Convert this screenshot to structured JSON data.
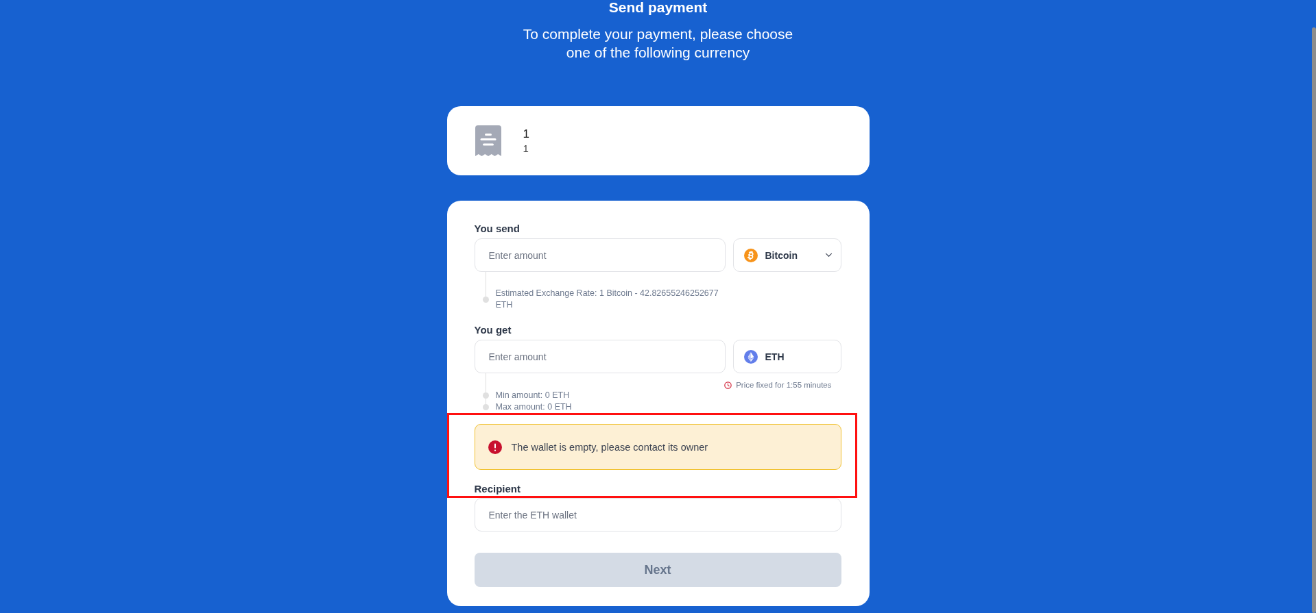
{
  "header": {
    "title": "Send payment",
    "subtitle": "To complete your payment, please choose one of the following currency"
  },
  "order": {
    "title": "1",
    "description": "1"
  },
  "send": {
    "label": "You send",
    "placeholder": "Enter amount",
    "currency": {
      "kind": "bitcoin",
      "name": "Bitcoin",
      "dropdown": true
    },
    "rate": "Estimated Exchange Rate: 1 Bitcoin - 42.82655246252677 ETH"
  },
  "get": {
    "label": "You get",
    "placeholder": "Enter amount",
    "currency": {
      "kind": "ethereum",
      "name": "ETH",
      "dropdown": false
    },
    "price_fixed": "Price fixed for 1:55 minutes",
    "limits": [
      "Min amount: 0 ETH",
      "Max amount: 0 ETH"
    ]
  },
  "alert": {
    "message": "The wallet is empty, please contact its owner"
  },
  "recipient": {
    "label": "Recipient",
    "placeholder": "Enter the ETH wallet"
  },
  "next_button": {
    "label": "Next",
    "disabled": true
  }
}
